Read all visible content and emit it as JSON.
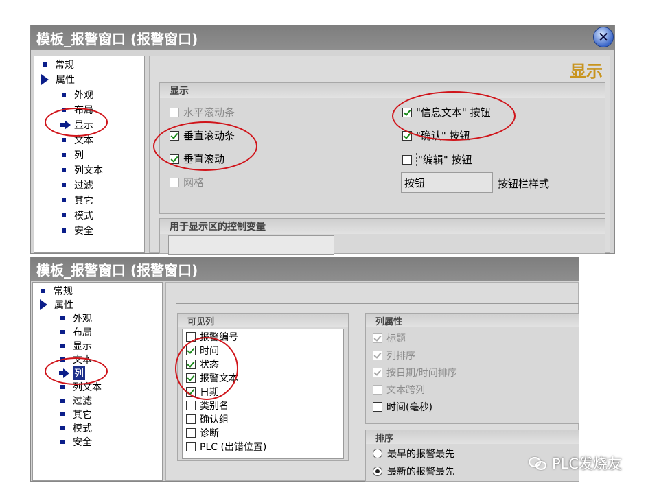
{
  "top": {
    "title": "模板_报警窗口 (报警窗口)",
    "nav": [
      "常规",
      "属性",
      "外观",
      "布局",
      "显示",
      "文本",
      "列",
      "列文本",
      "过滤",
      "其它",
      "模式",
      "安全"
    ],
    "page_heading": "显示",
    "display_group": {
      "title": "显示",
      "options": [
        {
          "label": "水平滚动条",
          "checked": false
        },
        {
          "label": "垂直滚动条",
          "checked": true
        },
        {
          "label": "垂直滚动",
          "checked": true
        },
        {
          "label": "网格",
          "checked": false
        },
        {
          "label": "\"信息文本\" 按钮",
          "checked": true
        },
        {
          "label": "\"确认\" 按钮",
          "checked": true
        },
        {
          "label": "\"编辑\" 按钮",
          "checked": false
        }
      ],
      "button_style_value": "按钮",
      "button_style_label": "按钮栏样式"
    },
    "control_group_title": "用于显示区的控制变量"
  },
  "bottom": {
    "title": "模板_报警窗口 (报警窗口)",
    "nav": [
      "常规",
      "属性",
      "外观",
      "布局",
      "显示",
      "文本",
      "列",
      "列文本",
      "过滤",
      "其它",
      "模式",
      "安全"
    ],
    "visible_columns": {
      "title": "可见列",
      "items": [
        {
          "label": "报警编号",
          "checked": false
        },
        {
          "label": "时间",
          "checked": true
        },
        {
          "label": "状态",
          "checked": true
        },
        {
          "label": "报警文本",
          "checked": true
        },
        {
          "label": "日期",
          "checked": true
        },
        {
          "label": "类别名",
          "checked": false
        },
        {
          "label": "确认组",
          "checked": false
        },
        {
          "label": "诊断",
          "checked": false
        },
        {
          "label": "PLC (出错位置)",
          "checked": false
        }
      ]
    },
    "column_props": {
      "title": "列属性",
      "items": [
        {
          "label": "标题",
          "checked": true
        },
        {
          "label": "列排序",
          "checked": true
        },
        {
          "label": "按日期/时间排序",
          "checked": true
        },
        {
          "label": "文本跨列",
          "checked": false
        },
        {
          "label": "时间(毫秒)",
          "checked": false
        }
      ]
    },
    "sort": {
      "title": "排序",
      "options": [
        {
          "label": "最早的报警最先",
          "selected": false
        },
        {
          "label": "最新的报警最先",
          "selected": true
        }
      ]
    }
  },
  "watermark": "PLC发烧友",
  "colors": {
    "annotation": "#d0141a",
    "check": "#1a8a1a",
    "nav_bullet": "#0b1e8a",
    "heading": "#c8941e"
  }
}
